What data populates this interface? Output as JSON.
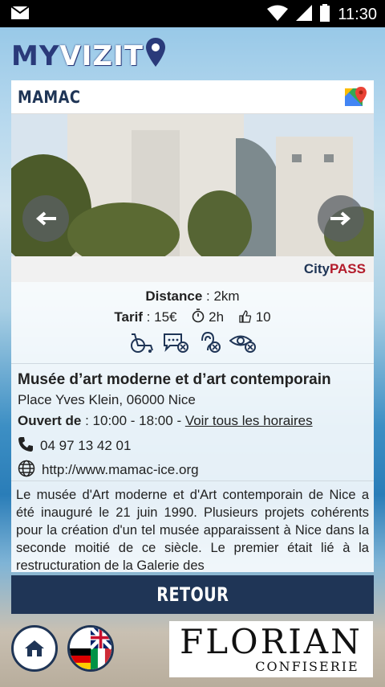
{
  "status_bar": {
    "time": "11:30"
  },
  "app": {
    "logo_my": "MY",
    "logo_vizit": "VIZIT"
  },
  "place": {
    "title": "MAMAC",
    "citypass_city": "City",
    "citypass_pass": "PASS",
    "distance_label": "Distance",
    "distance_value": " : 2km",
    "tarif_label": "Tarif",
    "tarif_value": " : 15€",
    "duration": "2h",
    "likes": "10",
    "name": "Musée d’art moderne et d’art contemporain",
    "address": "Place Yves Klein, 06000 Nice",
    "hours_label": "Ouvert de",
    "hours_value": " : 10:00 - 18:00 - ",
    "hours_link": "Voir tous les horaires",
    "phone": "04 97 13 42 01",
    "website": "http://www.mamac-ice.org",
    "description": "Le musée d'Art moderne et d'Art contemporain de Nice a été inauguré le 21 juin 1990. Plusieurs projets cohérents pour la création d'un tel musée apparaissent à Nice dans la seconde moitié de ce siècle. Le premier était lié à la restructuration de la Galerie des"
  },
  "footer": {
    "retour_label": "RETOUR",
    "sponsor_name": "FLORIAN",
    "sponsor_sub": "CONFISERIE"
  },
  "icons": {
    "accessibility": [
      "wheelchair-icon",
      "speech-disabled-icon",
      "hearing-disabled-icon",
      "visual-disabled-icon"
    ]
  },
  "colors": {
    "brand": "#1f3556",
    "citypass_red": "#b31b2a"
  }
}
